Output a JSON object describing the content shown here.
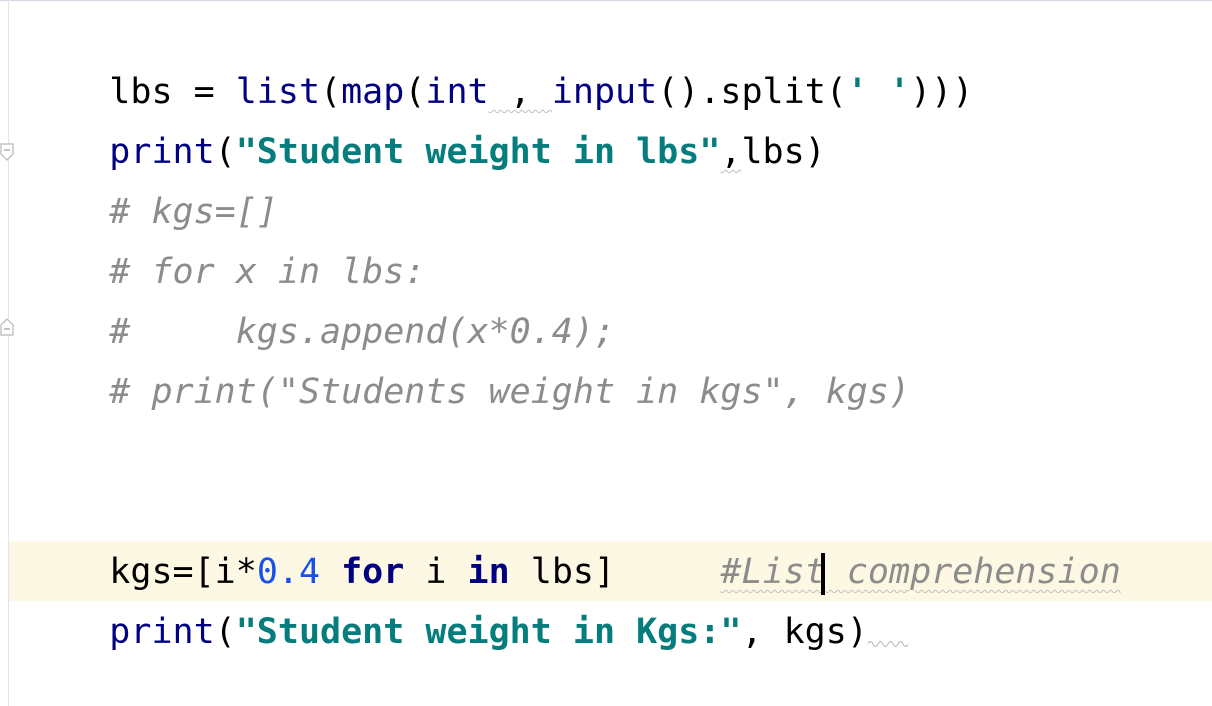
{
  "editor": {
    "lines": {
      "l1": {
        "t1": "lbs = ",
        "t2": "list",
        "t3": "(",
        "t4": "map",
        "t5": "(",
        "t6": "int",
        "t7": " , ",
        "t8": "input",
        "t9": "().split(",
        "t10": "' '",
        "t11": ")))"
      },
      "l2": {
        "t1": "print",
        "t2": "(",
        "t3": "\"Student weight in lbs\"",
        "t4": ",",
        "t5": "lbs)"
      },
      "l3": {
        "t1": "# kgs=[]"
      },
      "l4": {
        "t1": "# for x in lbs:"
      },
      "l5": {
        "t1": "#     kgs.append(x*0.4);"
      },
      "l6": {
        "t1": "# print(\"Students weight in kgs\", kgs)"
      },
      "l7": {
        "t1": "kgs=[i*",
        "t2": "0.4",
        "t3": " ",
        "t4": "for",
        "t5": " i ",
        "t6": "in",
        "t7": " lbs]     ",
        "t8": "#List comprehension"
      },
      "l8": {
        "t1": "print",
        "t2": "(",
        "t3": "\"Student weight in Kgs:\"",
        "t4": ", kgs)"
      }
    },
    "colors": {
      "keyword": "#000080",
      "string": "#067d7d",
      "number": "#1750eb",
      "comment": "#8c8c8c",
      "current_line": "#fdf8e3"
    },
    "icons": [
      "fold-start-icon",
      "fold-end-icon",
      "text-caret"
    ]
  }
}
